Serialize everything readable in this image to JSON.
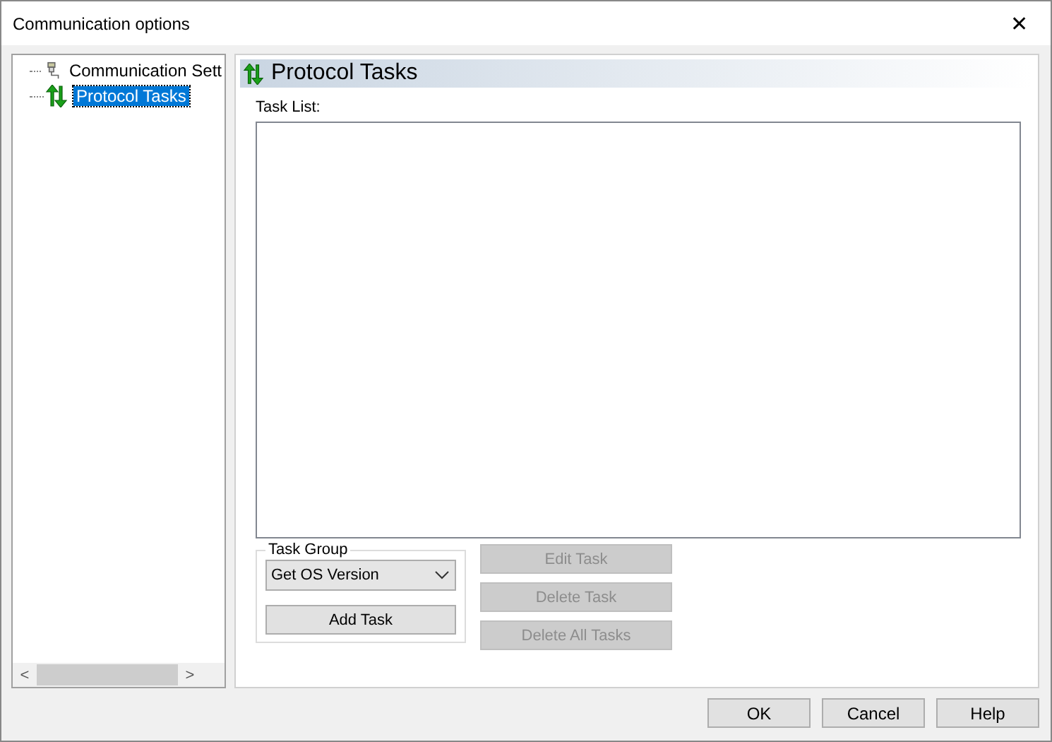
{
  "window": {
    "title": "Communication options",
    "close": "✕"
  },
  "tree": {
    "items": [
      {
        "label": "Communication Sett",
        "kind": "connection",
        "selected": false
      },
      {
        "label": "Protocol Tasks",
        "kind": "tasks",
        "selected": true
      }
    ],
    "scroll_left": "<",
    "scroll_right": ">"
  },
  "panel": {
    "title": "Protocol Tasks",
    "task_list_label": "Task List:",
    "task_group": {
      "legend": "Task Group",
      "dropdown_value": "Get OS Version",
      "add_button": {
        "label": "Add Task",
        "disabled": false
      }
    },
    "task_buttons": [
      {
        "label": "Edit Task",
        "disabled": true
      },
      {
        "label": "Delete Task",
        "disabled": true
      },
      {
        "label": "Delete All Tasks",
        "disabled": true
      }
    ]
  },
  "buttons": [
    {
      "label": "OK"
    },
    {
      "label": "Cancel"
    },
    {
      "label": "Help"
    }
  ]
}
